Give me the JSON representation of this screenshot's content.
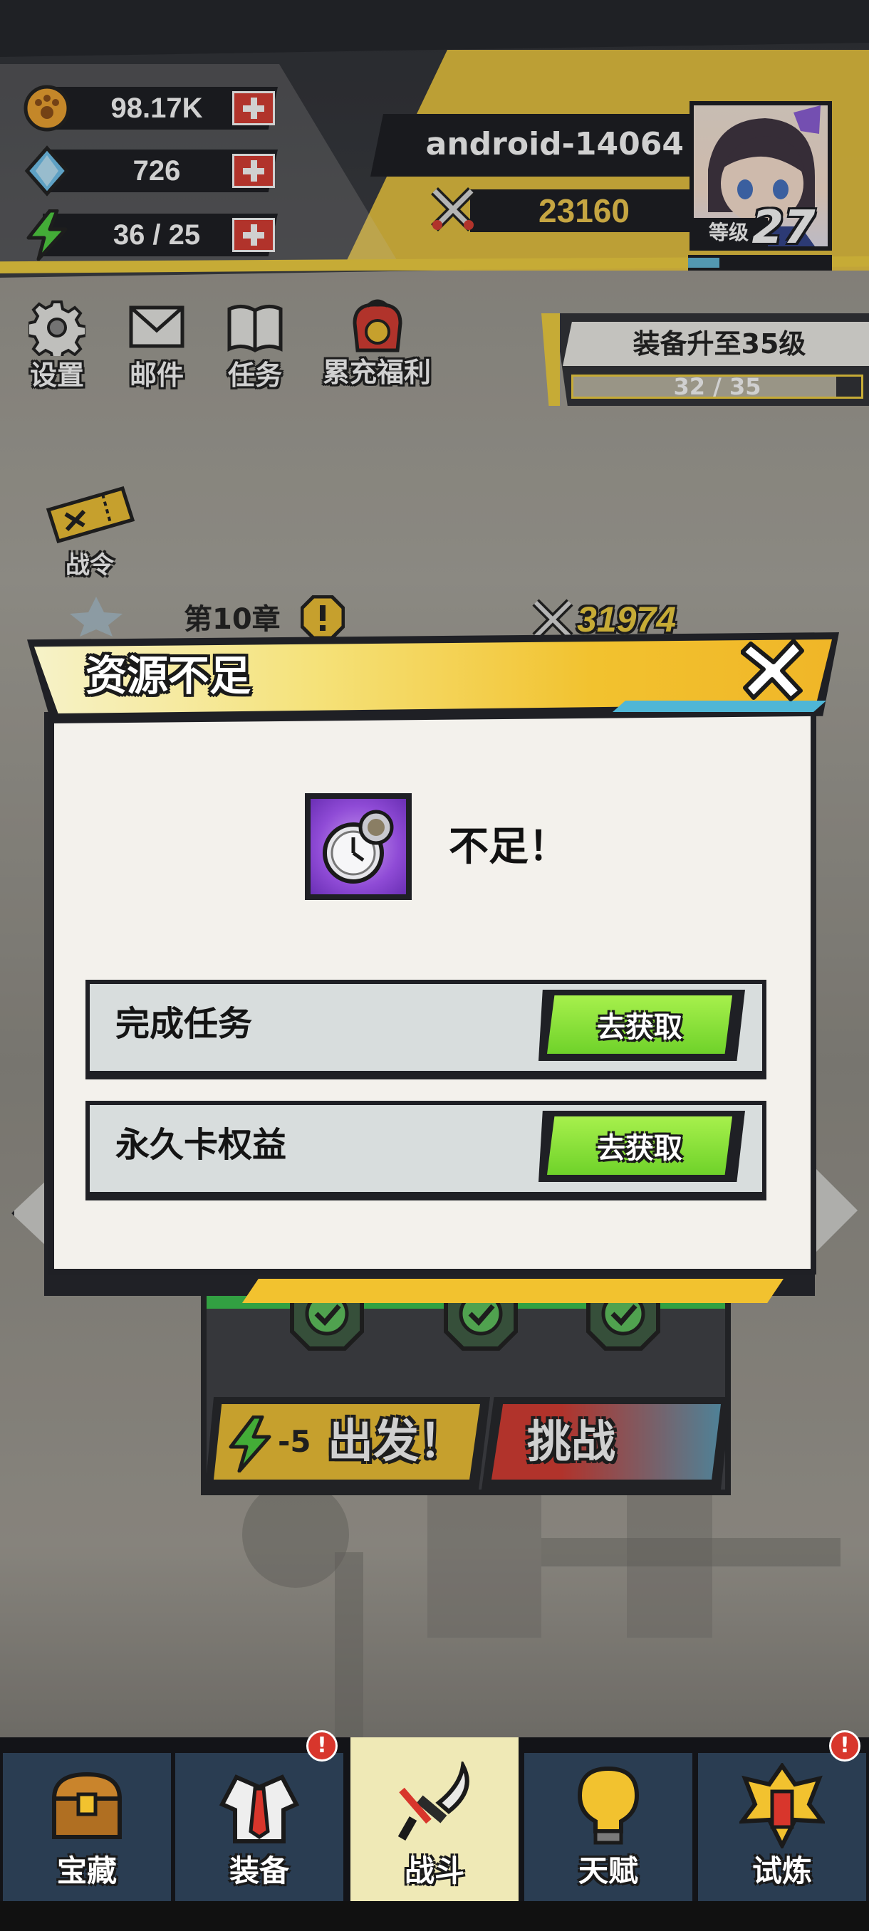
{
  "resources": {
    "gold": "98.17K",
    "gems": "726",
    "energy": "36 / 25"
  },
  "player": {
    "name": "android-14064",
    "power": "23160",
    "level_label": "等级",
    "level": "27",
    "xp_fraction": 0.22
  },
  "quick_menu": [
    {
      "label": "设置",
      "icon": "gear-icon"
    },
    {
      "label": "邮件",
      "icon": "mail-icon"
    },
    {
      "label": "任务",
      "icon": "book-icon"
    },
    {
      "label": "累充福利",
      "icon": "gift-bag-icon"
    }
  ],
  "goal": {
    "title": "装备升至35级",
    "progress_text": "32 / 35",
    "progress_fraction": 0.914
  },
  "battle_pass": {
    "label": "战令"
  },
  "chapter": {
    "title": "第10章",
    "recommended_power": "31974"
  },
  "dialog": {
    "title": "资源不足",
    "item_message": "不足！",
    "options": [
      {
        "label": "完成任务",
        "button": "去获取"
      },
      {
        "label": "永久卡权益",
        "button": "去获取"
      }
    ]
  },
  "stage_actions": {
    "go_cost": "-5",
    "go_label": "出发！",
    "challenge_label": "挑战"
  },
  "bottom_nav": [
    {
      "label": "宝藏",
      "icon": "treasure-chest-icon",
      "badge": false,
      "active": false
    },
    {
      "label": "装备",
      "icon": "uniform-icon",
      "badge": true,
      "active": false
    },
    {
      "label": "战斗",
      "icon": "sword-icon",
      "badge": false,
      "active": true
    },
    {
      "label": "天赋",
      "icon": "lightbulb-icon",
      "badge": false,
      "active": false
    },
    {
      "label": "试炼",
      "icon": "trial-emblem-icon",
      "badge": true,
      "active": false
    }
  ],
  "badge_text": "!",
  "colors": {
    "accent_yellow": "#f3d03a",
    "energy_green": "#4bd13b",
    "button_green": "#7bdc30",
    "alert_red": "#d8362c",
    "nav_blue": "#2a3d52"
  }
}
